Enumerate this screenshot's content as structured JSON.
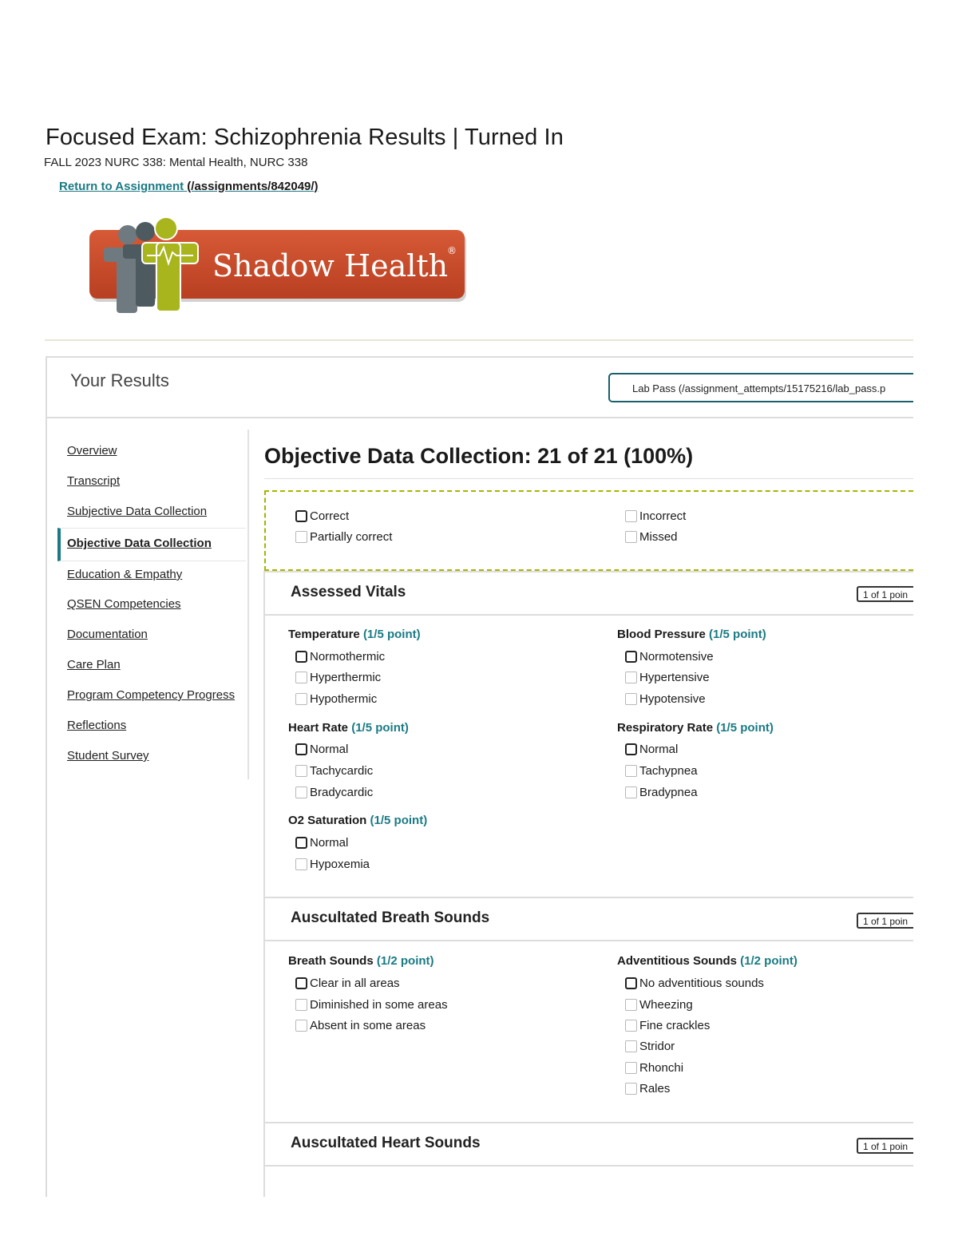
{
  "header": {
    "title": "Focused Exam: Schizophrenia Results | Turned In",
    "course": "FALL 2023 NURC 338: Mental Health, NURC 338",
    "return_label": "Return to Assignment",
    "return_path": "(/assignments/842049/)"
  },
  "logo": {
    "text": "Shadow Health",
    "mark": "®"
  },
  "results": {
    "title": "Your Results",
    "lab_pass": "Lab Pass (/assignment_attempts/15175216/lab_pass.p"
  },
  "sidebar": {
    "items": [
      {
        "label": "Overview"
      },
      {
        "label": "Transcript"
      },
      {
        "label": "Subjective Data Collection"
      },
      {
        "label": "Objective Data Collection",
        "active": true
      },
      {
        "label": "Education & Empathy"
      },
      {
        "label": "QSEN Competencies"
      },
      {
        "label": "Documentation"
      },
      {
        "label": "Care Plan"
      },
      {
        "label": "Program Competency Progress"
      },
      {
        "label": "Reflections"
      },
      {
        "label": "Student Survey"
      }
    ]
  },
  "section": {
    "title": "Objective Data Collection: 21 of 21 (100%)"
  },
  "legend": {
    "correct": "Correct",
    "partially_correct": "Partially correct",
    "incorrect": "Incorrect",
    "missed": "Missed"
  },
  "cards": [
    {
      "title": "Assessed Vitals",
      "points": "1 of 1 poin",
      "questions": [
        {
          "label": "Temperature",
          "pts": "(1/5 point)",
          "options": [
            "Normothermic",
            "Hyperthermic",
            "Hypothermic"
          ],
          "selected": 0
        },
        {
          "label": "Blood Pressure",
          "pts": "(1/5 point)",
          "options": [
            "Normotensive",
            "Hypertensive",
            "Hypotensive"
          ],
          "selected": 0
        },
        {
          "label": "Heart Rate",
          "pts": "(1/5 point)",
          "options": [
            "Normal",
            "Tachycardic",
            "Bradycardic"
          ],
          "selected": 0
        },
        {
          "label": "Respiratory Rate",
          "pts": "(1/5 point)",
          "options": [
            "Normal",
            "Tachypnea",
            "Bradypnea"
          ],
          "selected": 0
        },
        {
          "label": "O2 Saturation",
          "pts": "(1/5 point)",
          "options": [
            "Normal",
            "Hypoxemia"
          ],
          "selected": 0
        }
      ]
    },
    {
      "title": "Auscultated Breath Sounds",
      "points": "1 of 1 poin",
      "questions": [
        {
          "label": "Breath Sounds",
          "pts": "(1/2 point)",
          "options": [
            "Clear in all areas",
            "Diminished in some areas",
            "Absent in some areas"
          ],
          "selected": 0
        },
        {
          "label": "Adventitious Sounds",
          "pts": "(1/2 point)",
          "options": [
            "No adventitious sounds",
            "Wheezing",
            "Fine crackles",
            "Stridor",
            "Rhonchi",
            "Rales"
          ],
          "selected": 0
        }
      ]
    },
    {
      "title": "Auscultated Heart Sounds",
      "points": "1 of 1 poin"
    }
  ],
  "colors": {
    "teal": "#1a7a84",
    "logo_orange": "#c4482a",
    "logo_lime": "#a9b51c",
    "legend_dash": "#a8b400"
  }
}
